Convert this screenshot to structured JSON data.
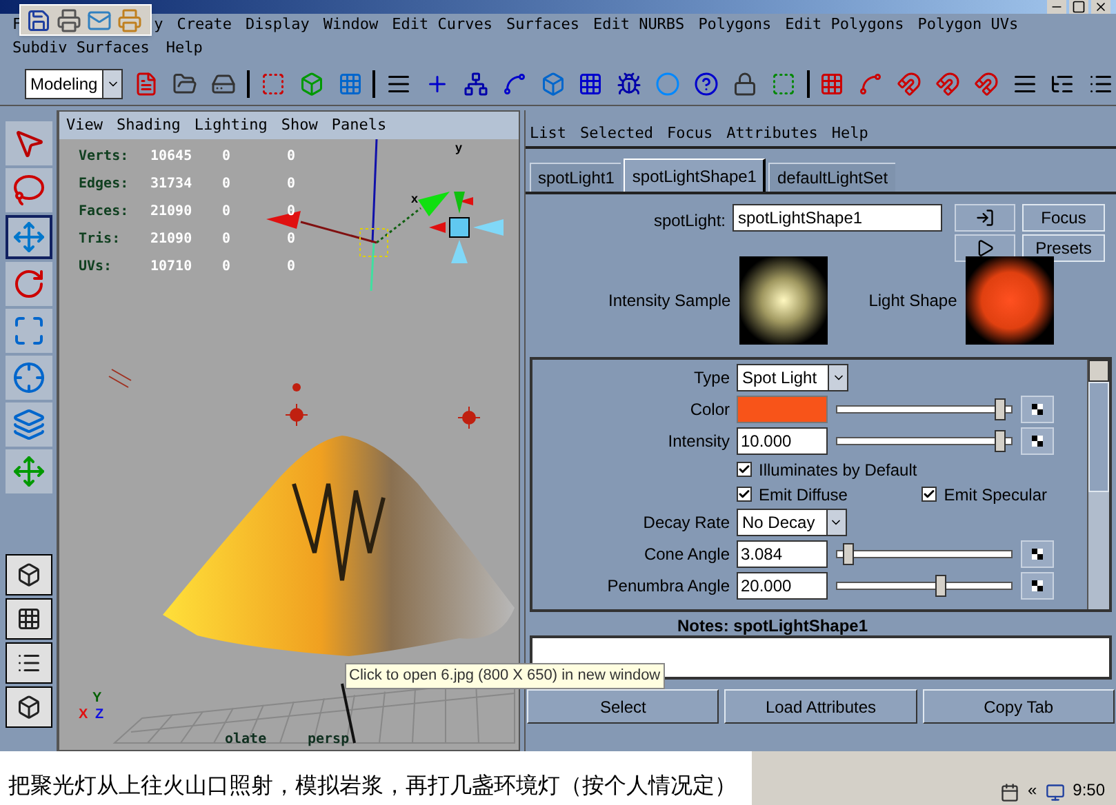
{
  "menu_bar": {
    "row_1": [
      "F",
      "y",
      "Create",
      "Display",
      "Window",
      "Edit Curves",
      "Surfaces",
      "Edit NURBS",
      "Polygons",
      "Edit Polygons",
      "Polygon UVs"
    ],
    "row_2": [
      "Subdiv Surfaces",
      "Help"
    ]
  },
  "shelf": {
    "mode": "Modeling"
  },
  "viewport": {
    "menu": [
      "View",
      "Shading",
      "Lighting",
      "Show",
      "Panels"
    ],
    "stats": [
      {
        "label": "Verts:",
        "values": [
          "10645",
          "0",
          "0"
        ]
      },
      {
        "label": "Edges:",
        "values": [
          "31734",
          "0",
          "0"
        ]
      },
      {
        "label": "Faces:",
        "values": [
          "21090",
          "0",
          "0"
        ]
      },
      {
        "label": "Tris:",
        "values": [
          "21090",
          "0",
          "0"
        ]
      },
      {
        "label": "UVs:",
        "values": [
          "10710",
          "0",
          "0"
        ]
      }
    ],
    "view_axes": [
      "y",
      "x"
    ],
    "corner_axes": [
      "Y",
      "X",
      "Z"
    ],
    "camera_labels": [
      "olate",
      "persp"
    ]
  },
  "attribute_editor": {
    "menu": [
      "List",
      "Selected",
      "Focus",
      "Attributes",
      "Help"
    ],
    "tabs": [
      {
        "label": "spotLight1",
        "selected": false
      },
      {
        "label": "spotLightShape1",
        "selected": true
      },
      {
        "label": "defaultLightSet",
        "selected": false
      }
    ],
    "node_label": "spotLight:",
    "node_value": "spotLightShape1",
    "side_buttons": [
      "Focus",
      "Presets"
    ],
    "swatches": [
      "Intensity Sample",
      "Light Shape"
    ],
    "attributes": [
      {
        "kind": "dropdown",
        "label": "Type",
        "value": "Spot Light"
      },
      {
        "kind": "color",
        "label": "Color",
        "color": "#f85419",
        "level": 0.96
      },
      {
        "kind": "slider",
        "label": "Intensity",
        "value": "10.000",
        "level": 0.96
      },
      {
        "kind": "check",
        "items": [
          {
            "label": "Illuminates by Default",
            "checked": true
          }
        ]
      },
      {
        "kind": "check",
        "items": [
          {
            "label": "Emit Diffuse",
            "checked": true
          },
          {
            "label": "Emit Specular",
            "checked": true
          }
        ]
      },
      {
        "kind": "dropdown",
        "label": "Decay Rate",
        "value": "No Decay"
      },
      {
        "kind": "slider",
        "label": "Cone Angle",
        "value": "3.084",
        "level": 0.04
      },
      {
        "kind": "slider",
        "label": "Penumbra Angle",
        "value": "20.000",
        "level": 0.6
      }
    ],
    "notes_title": "Notes: spotLightShape1",
    "buttons": [
      "Select",
      "Load Attributes",
      "Copy Tab"
    ]
  },
  "tooltip": "Click to open 6.jpg (800 X 650) in new window",
  "caption": "把聚光灯从上往火山口照射，模拟岩浆，再打几盏环境灯（按个人情况定）",
  "taskbar": {
    "tray_arrow": "«",
    "clock": "9:50"
  }
}
